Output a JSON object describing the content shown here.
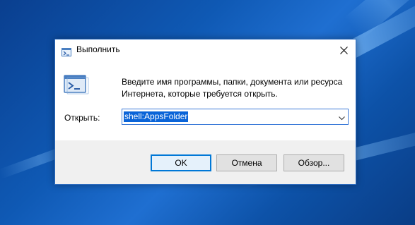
{
  "window": {
    "title": "Выполнить"
  },
  "content": {
    "description": "Введите имя программы, папки, документа или ресурса Интернета, которые требуется открыть.",
    "open_label": "Открыть:",
    "input_value": "shell:AppsFolder"
  },
  "buttons": {
    "ok": "OK",
    "cancel": "Отмена",
    "browse": "Обзор..."
  },
  "icons": {
    "title": "run-icon",
    "big": "run-icon",
    "close": "close-icon",
    "dropdown": "chevron-down-icon"
  },
  "colors": {
    "accent": "#0078d7",
    "selection": "#0a64d8",
    "desktop": "#0f59b4"
  }
}
